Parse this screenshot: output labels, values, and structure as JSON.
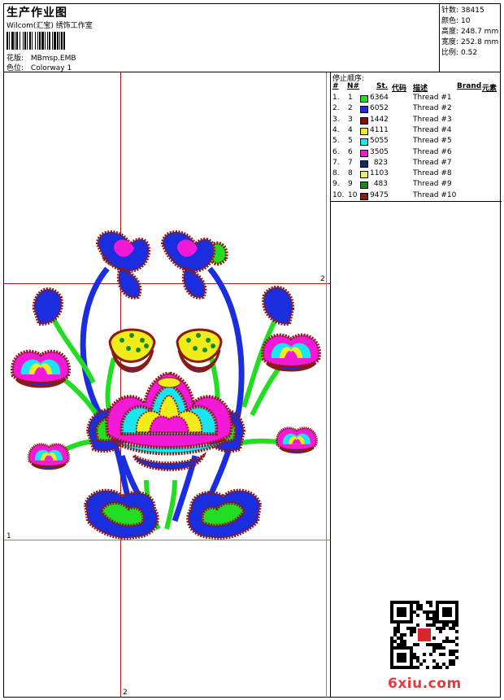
{
  "header": {
    "title": "生产作业图",
    "subtitle": "Wilcom(汇宝) 绣饰工作室",
    "design_label": "花版:",
    "design_value": "MBmsp.EMB",
    "colorway_label": "色位:",
    "colorway_value": "Colorway 1"
  },
  "stats": [
    {
      "label": "针数:",
      "value": "38415"
    },
    {
      "label": "颜色:",
      "value": "10"
    },
    {
      "label": "高度:",
      "value": "248.7 mm"
    },
    {
      "label": "宽度:",
      "value": "252.8 mm"
    },
    {
      "label": "比例:",
      "value": "0.52"
    }
  ],
  "stop_sequence": {
    "label": "停止顺序:",
    "columns": [
      "#",
      "N#",
      "St.",
      "代码",
      "描述",
      "Brand",
      "元素"
    ],
    "rows": [
      {
        "idx": "1.",
        "n": "1",
        "color": "#22dd22",
        "st": "6364",
        "desc": "Thread #1"
      },
      {
        "idx": "2.",
        "n": "2",
        "color": "#1a2ee0",
        "st": "6052",
        "desc": "Thread #2"
      },
      {
        "idx": "3.",
        "n": "3",
        "color": "#8b0a0a",
        "st": "1442",
        "desc": "Thread #3"
      },
      {
        "idx": "4.",
        "n": "4",
        "color": "#f2ec1a",
        "st": "4111",
        "desc": "Thread #4"
      },
      {
        "idx": "5.",
        "n": "5",
        "color": "#18e6f2",
        "st": "5055",
        "desc": "Thread #5"
      },
      {
        "idx": "6.",
        "n": "6",
        "color": "#f21ad6",
        "st": "3505",
        "desc": "Thread #6"
      },
      {
        "idx": "7.",
        "n": "7",
        "color": "#0c2a7a",
        "st": "823",
        "desc": "Thread #7"
      },
      {
        "idx": "8.",
        "n": "8",
        "color": "#eeee66",
        "st": "1103",
        "desc": "Thread #8"
      },
      {
        "idx": "9.",
        "n": "9",
        "color": "#158c1a",
        "st": "483",
        "desc": "Thread #9"
      },
      {
        "idx": "10.",
        "n": "10",
        "color": "#8a1a14",
        "st": "9475",
        "desc": "Thread #10"
      }
    ]
  },
  "axis_marks": {
    "h1": "1",
    "h2": "2",
    "v2": "2"
  },
  "watermark": "6xiu.com",
  "icons": {
    "barcode": "barcode-icon",
    "qr": "qr-code-icon"
  }
}
